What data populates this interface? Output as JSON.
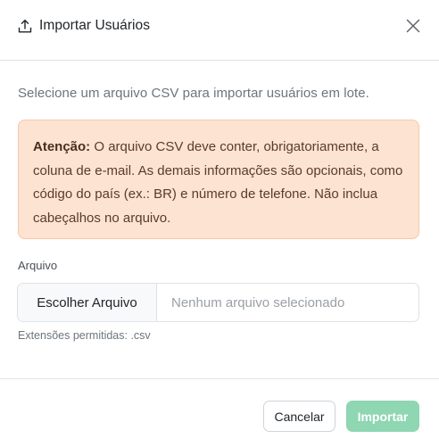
{
  "header": {
    "title": "Importar Usuários",
    "icon": "upload-icon",
    "close_icon": "close-icon"
  },
  "description": "Selecione um arquivo CSV para importar usuários em lote.",
  "alert": {
    "label": "Atenção:",
    "text": " O arquivo CSV deve conter, obrigatoriamente, a coluna de e-mail. As demais informações são opcionais, como código do país (ex.: BR) e número de telefone. Não inclua cabeçalhos no arquivo.",
    "background": "#fde3d2",
    "border": "#f9c7a8"
  },
  "file_field": {
    "label": "Arquivo",
    "button_label": "Escolher Arquivo",
    "placeholder": "Nenhum arquivo selecionado",
    "hint": "Extensões permitidas: .csv"
  },
  "footer": {
    "cancel_label": "Cancelar",
    "import_label": "Importar",
    "import_color": "#8fd6b3"
  }
}
